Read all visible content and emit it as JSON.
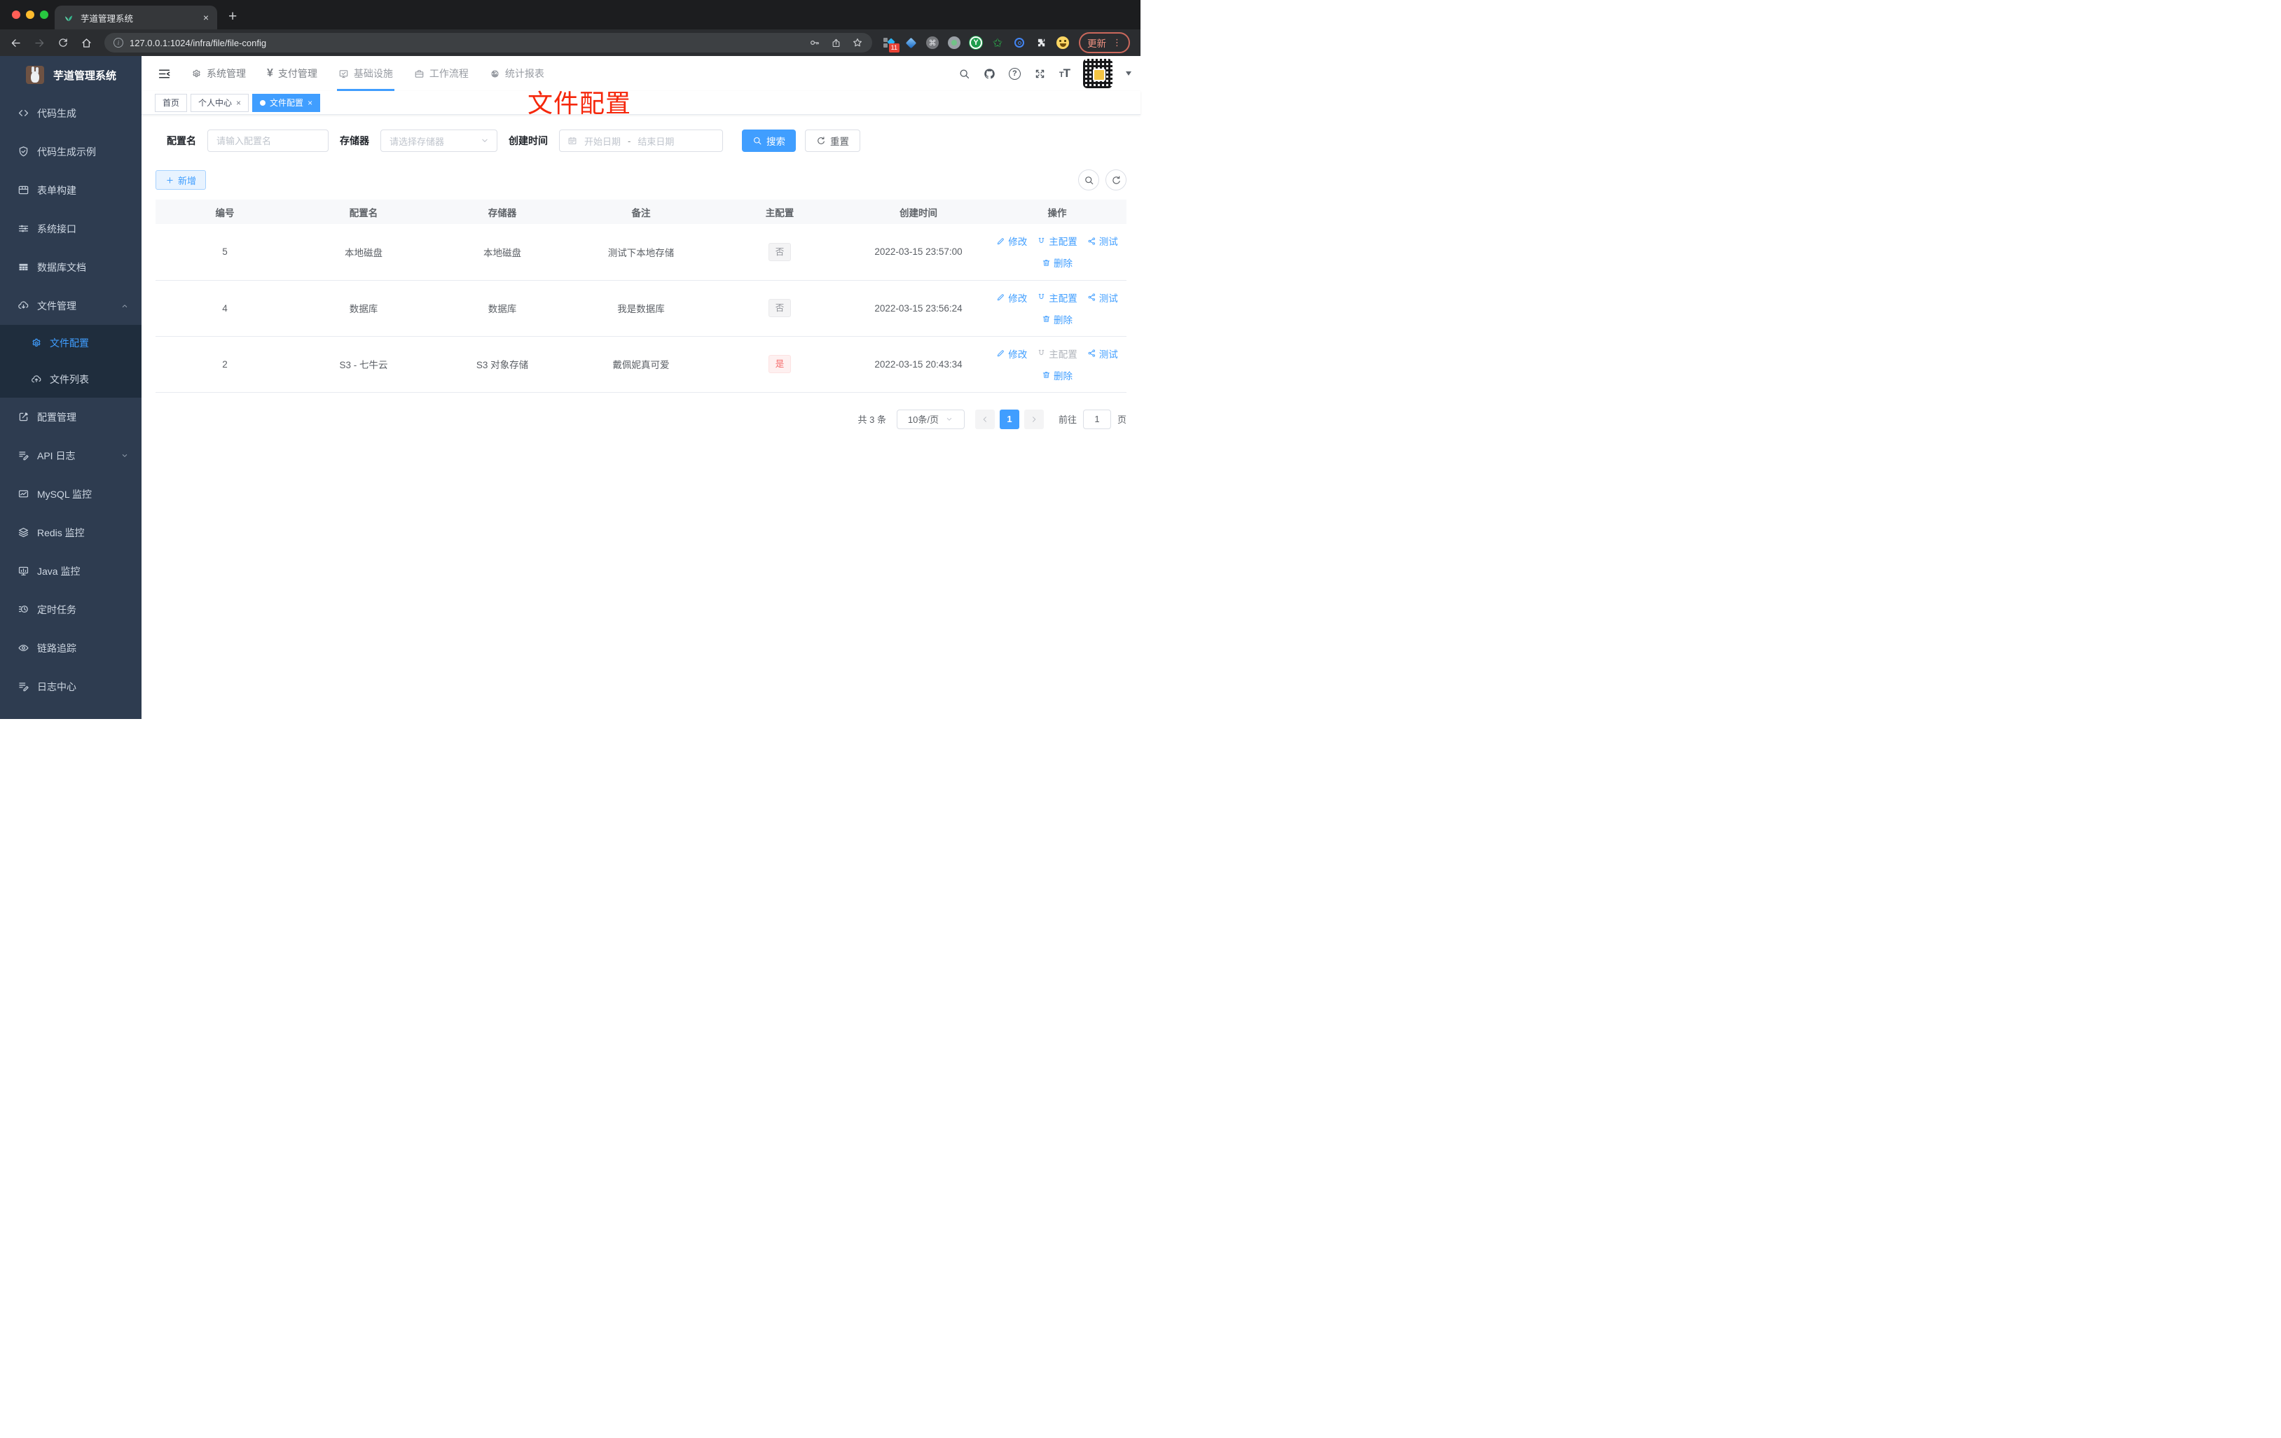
{
  "browser": {
    "tab_title": "芋道管理系统",
    "url": "127.0.0.1:1024/infra/file/file-config",
    "info_glyph": "i",
    "extension_badge": "11",
    "cmd_glyph": "⌘",
    "ext_y_glyph": "Y",
    "update_button": "更新",
    "menu_dots": "⋮",
    "new_tab_glyph": "+",
    "close_glyph": "×"
  },
  "sidebar": {
    "title": "芋道管理系统",
    "items_top": [
      {
        "label": "代码生成"
      },
      {
        "label": "代码生成示例"
      },
      {
        "label": "表单构建"
      },
      {
        "label": "系统接口"
      },
      {
        "label": "数据库文档"
      },
      {
        "label": "文件管理"
      }
    ],
    "submenu": [
      {
        "label": "文件配置"
      },
      {
        "label": "文件列表"
      }
    ],
    "items_bottom": [
      {
        "label": "配置管理"
      },
      {
        "label": "API 日志"
      },
      {
        "label": "MySQL 监控"
      },
      {
        "label": "Redis 监控"
      },
      {
        "label": "Java 监控"
      },
      {
        "label": "定时任务"
      },
      {
        "label": "链路追踪"
      },
      {
        "label": "日志中心"
      }
    ]
  },
  "navbar": {
    "menus": [
      {
        "label": "系统管理"
      },
      {
        "label": "支付管理"
      },
      {
        "label": "基础设施"
      },
      {
        "label": "工作流程"
      },
      {
        "label": "统计报表"
      }
    ],
    "yen_glyph": "¥",
    "help_glyph": "?",
    "font_size_small": "T",
    "font_size_big": "T"
  },
  "tags": [
    {
      "label": "首页"
    },
    {
      "label": "个人中心"
    },
    {
      "label": "文件配置"
    }
  ],
  "ui": {
    "close_glyph": "×"
  },
  "annotation": {
    "text": "文件配置",
    "color": "#f5270b"
  },
  "filters": {
    "config_name_label": "配置名",
    "config_name_placeholder": "请输入配置名",
    "storage_label": "存储器",
    "storage_placeholder": "请选择存储器",
    "create_time_label": "创建时间",
    "date_start_placeholder": "开始日期",
    "date_separator": "-",
    "date_end_placeholder": "结束日期",
    "search_button": "搜索",
    "reset_button": "重置"
  },
  "toolbar": {
    "add_button": "新增"
  },
  "table": {
    "columns": [
      "编号",
      "配置名",
      "存储器",
      "备注",
      "主配置",
      "创建时间",
      "操作"
    ],
    "actions": {
      "edit": "修改",
      "master": "主配置",
      "test": "测试",
      "delete": "删除"
    },
    "rows": [
      {
        "id": "5",
        "name": "本地磁盘",
        "storage": "本地磁盘",
        "remark": "测试下本地存储",
        "master": "否",
        "created": "2022-03-15 23:57:00"
      },
      {
        "id": "4",
        "name": "数据库",
        "storage": "数据库",
        "remark": "我是数据库",
        "master": "否",
        "created": "2022-03-15 23:56:24"
      },
      {
        "id": "2",
        "name": "S3 - 七牛云",
        "storage": "S3 对象存储",
        "remark": "戴佩妮真可爱",
        "master": "是",
        "created": "2022-03-15 20:43:34"
      }
    ]
  },
  "pagination": {
    "total": "共 3 条",
    "page_size": "10条/页",
    "current_page": "1",
    "goto_label": "前往",
    "goto_value": "1",
    "goto_suffix": "页"
  },
  "colors": {
    "accent": "#409eff",
    "danger": "#f56c6c",
    "annotation_red": "#f5270b",
    "sidebar_bg": "#2e3c50",
    "submenu_bg": "#1f2d3d"
  }
}
